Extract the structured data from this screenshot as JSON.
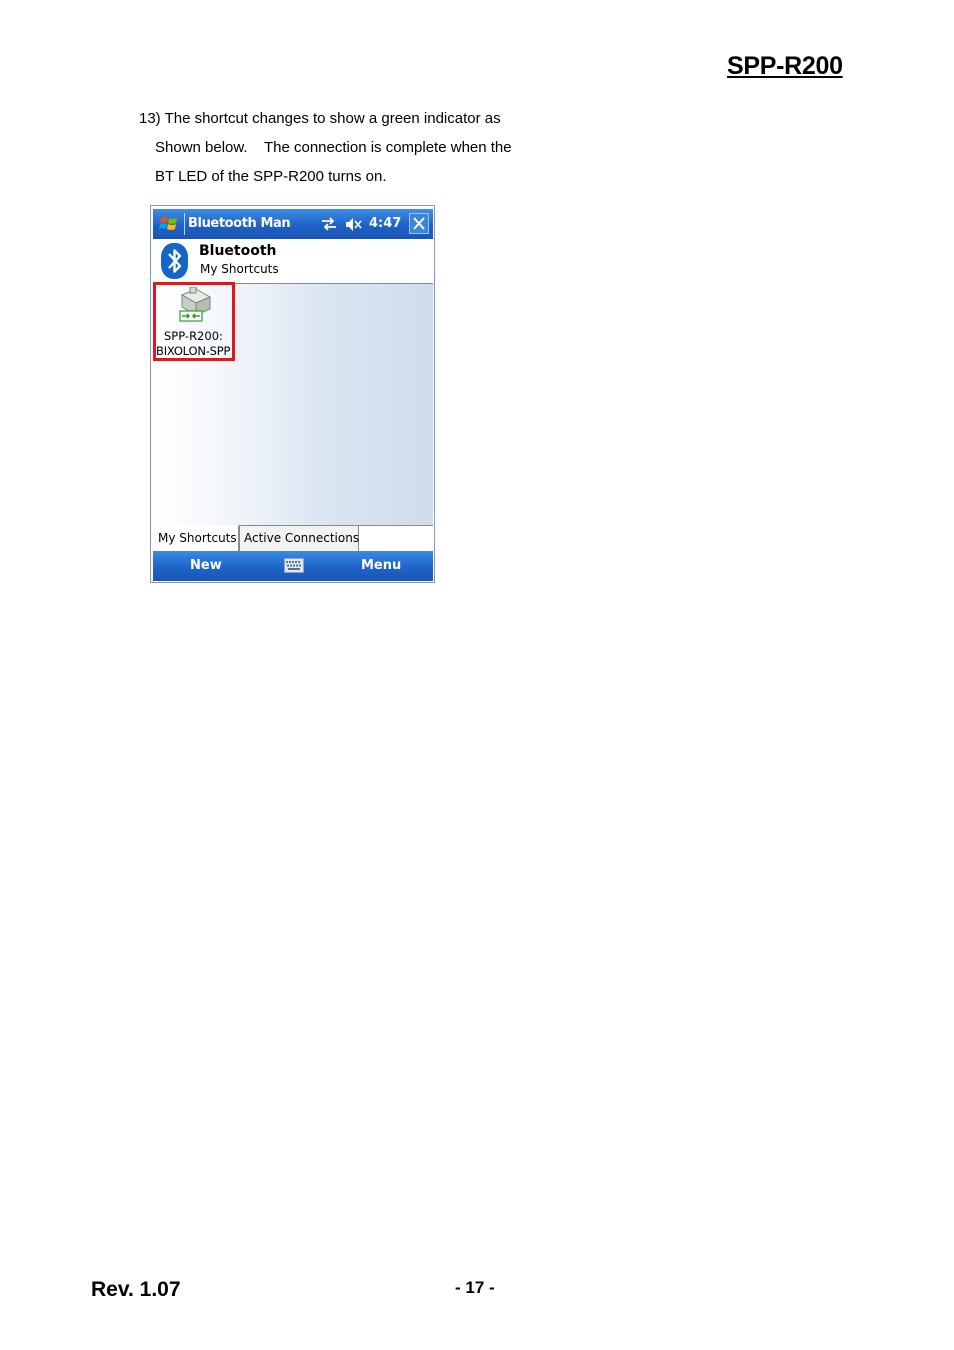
{
  "document": {
    "title": "SPP-R200",
    "paragraph": {
      "line1": "13) The shortcut changes to show a green indicator as",
      "line2": "Shown below.    The connection is complete when the",
      "line3": "BT LED of the SPP-R200 turns on."
    },
    "footer": {
      "revision": "Rev. 1.07",
      "page": "- 17 -"
    }
  },
  "screenshot": {
    "titlebar": {
      "start_icon": "windows-flag-icon",
      "title": "Bluetooth Manager",
      "sync_icon": "connectivity-icon",
      "volume_icon": "speaker-muted-icon",
      "time": "4:47",
      "close_icon": "close-icon"
    },
    "header": {
      "logo_icon": "bluetooth-icon",
      "title": "Bluetooth",
      "subtitle": "My Shortcuts"
    },
    "shortcut": {
      "icon": "serial-port-connected-icon",
      "line1": "SPP-R200:",
      "line2": "BIXOLON-SPP",
      "highlight_color": "#e8141c"
    },
    "tabs": [
      {
        "label": "My Shortcuts",
        "active": true
      },
      {
        "label": "Active Connections",
        "active": false
      }
    ],
    "menubar": {
      "left": "New",
      "keyboard_icon": "keyboard-icon",
      "right": "Menu"
    },
    "colors": {
      "bar_blue": "#1f63c8",
      "indicator_green": "#2ca02c"
    }
  }
}
